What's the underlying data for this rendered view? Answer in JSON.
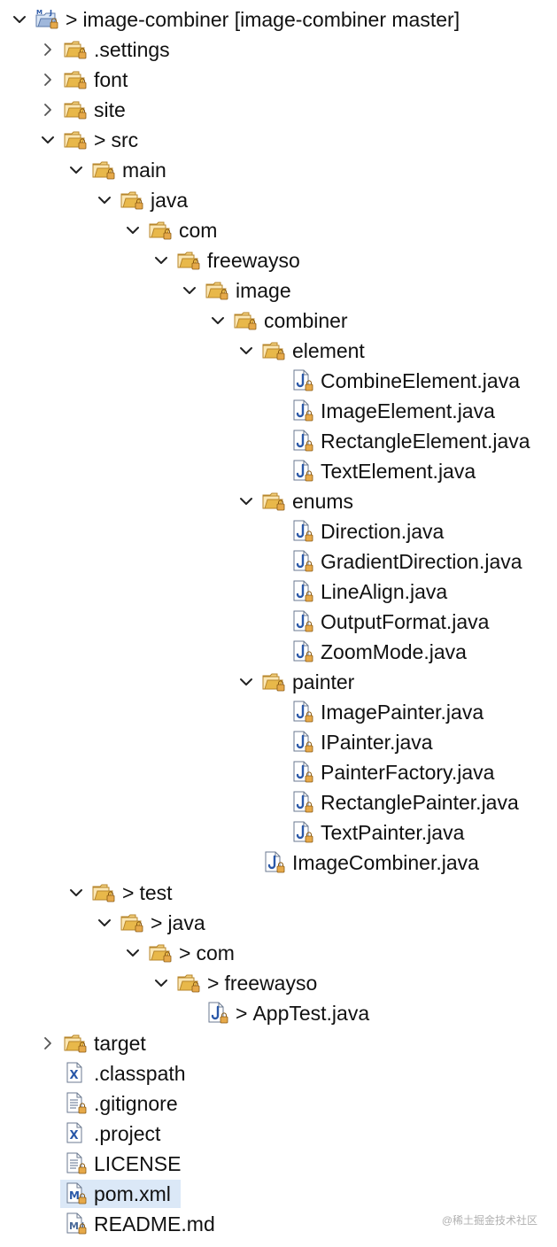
{
  "tree": [
    {
      "label": "image-combiner [image-combiner master]",
      "prefix": ">",
      "icon": "maven-project",
      "depth": 0,
      "expandable": true,
      "expanded": true,
      "selected": false
    },
    {
      "label": ".settings",
      "prefix": "",
      "icon": "folder",
      "depth": 1,
      "expandable": true,
      "expanded": false,
      "selected": false
    },
    {
      "label": "font",
      "prefix": "",
      "icon": "folder",
      "depth": 1,
      "expandable": true,
      "expanded": false,
      "selected": false
    },
    {
      "label": "site",
      "prefix": "",
      "icon": "folder",
      "depth": 1,
      "expandable": true,
      "expanded": false,
      "selected": false
    },
    {
      "label": "src",
      "prefix": ">",
      "icon": "folder",
      "depth": 1,
      "expandable": true,
      "expanded": true,
      "selected": false
    },
    {
      "label": "main",
      "prefix": "",
      "icon": "folder",
      "depth": 2,
      "expandable": true,
      "expanded": true,
      "selected": false
    },
    {
      "label": "java",
      "prefix": "",
      "icon": "folder",
      "depth": 3,
      "expandable": true,
      "expanded": true,
      "selected": false
    },
    {
      "label": "com",
      "prefix": "",
      "icon": "folder",
      "depth": 4,
      "expandable": true,
      "expanded": true,
      "selected": false
    },
    {
      "label": "freewayso",
      "prefix": "",
      "icon": "folder",
      "depth": 5,
      "expandable": true,
      "expanded": true,
      "selected": false
    },
    {
      "label": "image",
      "prefix": "",
      "icon": "folder",
      "depth": 6,
      "expandable": true,
      "expanded": true,
      "selected": false
    },
    {
      "label": "combiner",
      "prefix": "",
      "icon": "folder",
      "depth": 7,
      "expandable": true,
      "expanded": true,
      "selected": false
    },
    {
      "label": "element",
      "prefix": "",
      "icon": "folder",
      "depth": 8,
      "expandable": true,
      "expanded": true,
      "selected": false
    },
    {
      "label": "CombineElement.java",
      "prefix": "",
      "icon": "java-file",
      "depth": 9,
      "expandable": false,
      "expanded": false,
      "selected": false
    },
    {
      "label": "ImageElement.java",
      "prefix": "",
      "icon": "java-file",
      "depth": 9,
      "expandable": false,
      "expanded": false,
      "selected": false
    },
    {
      "label": "RectangleElement.java",
      "prefix": "",
      "icon": "java-file",
      "depth": 9,
      "expandable": false,
      "expanded": false,
      "selected": false
    },
    {
      "label": "TextElement.java",
      "prefix": "",
      "icon": "java-file",
      "depth": 9,
      "expandable": false,
      "expanded": false,
      "selected": false
    },
    {
      "label": "enums",
      "prefix": "",
      "icon": "folder",
      "depth": 8,
      "expandable": true,
      "expanded": true,
      "selected": false
    },
    {
      "label": "Direction.java",
      "prefix": "",
      "icon": "java-file",
      "depth": 9,
      "expandable": false,
      "expanded": false,
      "selected": false
    },
    {
      "label": "GradientDirection.java",
      "prefix": "",
      "icon": "java-file",
      "depth": 9,
      "expandable": false,
      "expanded": false,
      "selected": false
    },
    {
      "label": "LineAlign.java",
      "prefix": "",
      "icon": "java-file",
      "depth": 9,
      "expandable": false,
      "expanded": false,
      "selected": false
    },
    {
      "label": "OutputFormat.java",
      "prefix": "",
      "icon": "java-file",
      "depth": 9,
      "expandable": false,
      "expanded": false,
      "selected": false
    },
    {
      "label": "ZoomMode.java",
      "prefix": "",
      "icon": "java-file",
      "depth": 9,
      "expandable": false,
      "expanded": false,
      "selected": false
    },
    {
      "label": "painter",
      "prefix": "",
      "icon": "folder",
      "depth": 8,
      "expandable": true,
      "expanded": true,
      "selected": false
    },
    {
      "label": "ImagePainter.java",
      "prefix": "",
      "icon": "java-file",
      "depth": 9,
      "expandable": false,
      "expanded": false,
      "selected": false
    },
    {
      "label": "IPainter.java",
      "prefix": "",
      "icon": "java-file",
      "depth": 9,
      "expandable": false,
      "expanded": false,
      "selected": false
    },
    {
      "label": "PainterFactory.java",
      "prefix": "",
      "icon": "java-file",
      "depth": 9,
      "expandable": false,
      "expanded": false,
      "selected": false
    },
    {
      "label": "RectanglePainter.java",
      "prefix": "",
      "icon": "java-file",
      "depth": 9,
      "expandable": false,
      "expanded": false,
      "selected": false
    },
    {
      "label": "TextPainter.java",
      "prefix": "",
      "icon": "java-file",
      "depth": 9,
      "expandable": false,
      "expanded": false,
      "selected": false
    },
    {
      "label": "ImageCombiner.java",
      "prefix": "",
      "icon": "java-file",
      "depth": 8,
      "expandable": false,
      "expanded": false,
      "selected": false
    },
    {
      "label": "test",
      "prefix": ">",
      "icon": "folder",
      "depth": 2,
      "expandable": true,
      "expanded": true,
      "selected": false
    },
    {
      "label": "java",
      "prefix": ">",
      "icon": "folder",
      "depth": 3,
      "expandable": true,
      "expanded": true,
      "selected": false
    },
    {
      "label": "com",
      "prefix": ">",
      "icon": "folder",
      "depth": 4,
      "expandable": true,
      "expanded": true,
      "selected": false
    },
    {
      "label": "freewayso",
      "prefix": ">",
      "icon": "folder",
      "depth": 5,
      "expandable": true,
      "expanded": true,
      "selected": false
    },
    {
      "label": "AppTest.java",
      "prefix": ">",
      "icon": "java-file",
      "depth": 6,
      "expandable": false,
      "expanded": false,
      "selected": false
    },
    {
      "label": "target",
      "prefix": "",
      "icon": "folder",
      "depth": 1,
      "expandable": true,
      "expanded": false,
      "selected": false
    },
    {
      "label": ".classpath",
      "prefix": "",
      "icon": "xml-file",
      "depth": 1,
      "expandable": false,
      "expanded": false,
      "selected": false
    },
    {
      "label": ".gitignore",
      "prefix": "",
      "icon": "text-file",
      "depth": 1,
      "expandable": false,
      "expanded": false,
      "selected": false
    },
    {
      "label": ".project",
      "prefix": "",
      "icon": "xml-file",
      "depth": 1,
      "expandable": false,
      "expanded": false,
      "selected": false
    },
    {
      "label": "LICENSE",
      "prefix": "",
      "icon": "text-file",
      "depth": 1,
      "expandable": false,
      "expanded": false,
      "selected": false
    },
    {
      "label": "pom.xml",
      "prefix": "",
      "icon": "maven-pom-file",
      "depth": 1,
      "expandable": false,
      "expanded": false,
      "selected": true
    },
    {
      "label": "README.md",
      "prefix": "",
      "icon": "markdown-file",
      "depth": 1,
      "expandable": false,
      "expanded": false,
      "selected": false
    }
  ],
  "watermark": "@稀土掘金技术社区",
  "colors": {
    "folder": "#e8b84a",
    "folder_dark": "#b7862a",
    "java_blue": "#2a58a8",
    "selection": "#dbe8f7",
    "lock_badge": "#e6a94a"
  }
}
